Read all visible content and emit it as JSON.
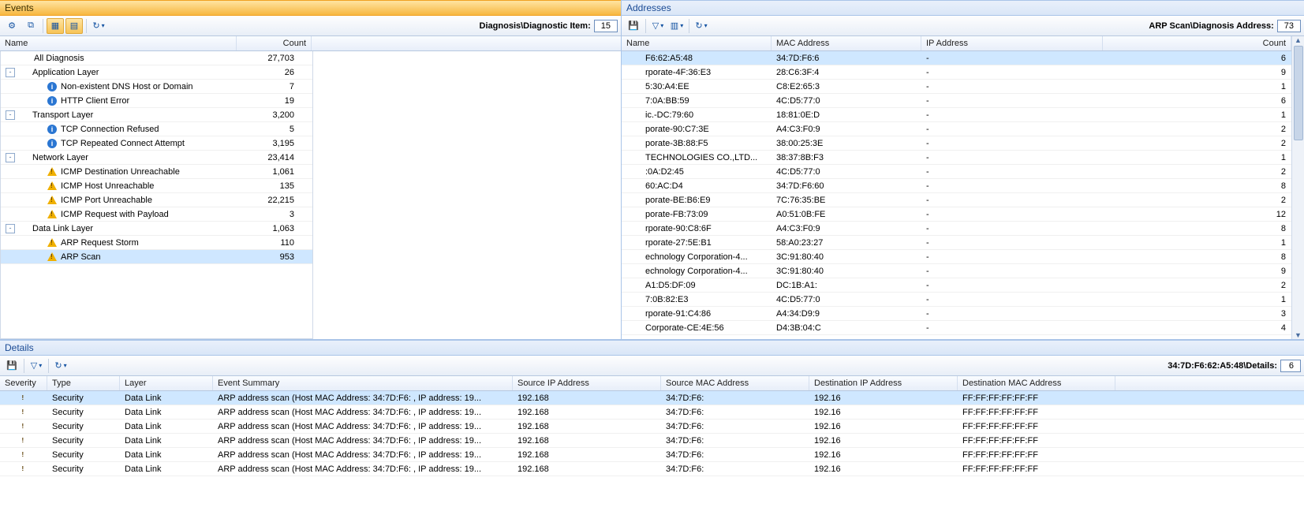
{
  "events": {
    "title": "Events",
    "breadcrumb_label": "Diagnosis\\Diagnostic Item:",
    "breadcrumb_count": "15",
    "columns": {
      "name": "Name",
      "count": "Count"
    },
    "tree": [
      {
        "label": "All Diagnosis",
        "count": "27,703",
        "indent": 1,
        "toggler": null,
        "icon": null
      },
      {
        "label": "Application Layer",
        "count": "26",
        "indent": 0,
        "toggler": "-",
        "icon": null
      },
      {
        "label": "Non-existent DNS Host or Domain",
        "count": "7",
        "indent": 2,
        "toggler": null,
        "icon": "info"
      },
      {
        "label": "HTTP Client Error",
        "count": "19",
        "indent": 2,
        "toggler": null,
        "icon": "info"
      },
      {
        "label": "Transport Layer",
        "count": "3,200",
        "indent": 0,
        "toggler": "-",
        "icon": null
      },
      {
        "label": "TCP Connection Refused",
        "count": "5",
        "indent": 2,
        "toggler": null,
        "icon": "info"
      },
      {
        "label": "TCP Repeated Connect Attempt",
        "count": "3,195",
        "indent": 2,
        "toggler": null,
        "icon": "info"
      },
      {
        "label": "Network Layer",
        "count": "23,414",
        "indent": 0,
        "toggler": "-",
        "icon": null
      },
      {
        "label": "ICMP Destination Unreachable",
        "count": "1,061",
        "indent": 2,
        "toggler": null,
        "icon": "warn"
      },
      {
        "label": "ICMP Host Unreachable",
        "count": "135",
        "indent": 2,
        "toggler": null,
        "icon": "warn"
      },
      {
        "label": "ICMP Port Unreachable",
        "count": "22,215",
        "indent": 2,
        "toggler": null,
        "icon": "warn"
      },
      {
        "label": "ICMP Request with Payload",
        "count": "3",
        "indent": 2,
        "toggler": null,
        "icon": "warn"
      },
      {
        "label": "Data Link Layer",
        "count": "1,063",
        "indent": 0,
        "toggler": "-",
        "icon": null
      },
      {
        "label": "ARP Request Storm",
        "count": "110",
        "indent": 2,
        "toggler": null,
        "icon": "warn"
      },
      {
        "label": "ARP Scan",
        "count": "953",
        "indent": 2,
        "toggler": null,
        "icon": "warn",
        "selected": true
      }
    ]
  },
  "addresses": {
    "title": "Addresses",
    "breadcrumb_label": "ARP Scan\\Diagnosis Address:",
    "breadcrumb_count": "73",
    "columns": {
      "name": "Name",
      "mac": "MAC Address",
      "ip": "IP Address",
      "count": "Count"
    },
    "rows": [
      {
        "name": "F6:62:A5:48",
        "mac": "34:7D:F6:6",
        "ip": "-",
        "count": "6",
        "selected": true
      },
      {
        "name": "rporate-4F:36:E3",
        "mac": "28:C6:3F:4",
        "ip": "-",
        "count": "9"
      },
      {
        "name": "5:30:A4:EE",
        "mac": "C8:E2:65:3",
        "ip": "-",
        "count": "1"
      },
      {
        "name": "7:0A:BB:59",
        "mac": "4C:D5:77:0",
        "ip": "-",
        "count": "6"
      },
      {
        "name": "ic.-DC:79:60",
        "mac": "18:81:0E:D",
        "ip": "-",
        "count": "1"
      },
      {
        "name": "porate-90:C7:3E",
        "mac": "A4:C3:F0:9",
        "ip": "-",
        "count": "2"
      },
      {
        "name": "porate-3B:88:F5",
        "mac": "38:00:25:3E",
        "ip": "-",
        "count": "2"
      },
      {
        "name": "TECHNOLOGIES CO.,LTD...",
        "mac": "38:37:8B:F3",
        "ip": "-",
        "count": "1"
      },
      {
        "name": ":0A:D2:45",
        "mac": "4C:D5:77:0",
        "ip": "-",
        "count": "2"
      },
      {
        "name": "60:AC:D4",
        "mac": "34:7D:F6:60",
        "ip": "-",
        "count": "8"
      },
      {
        "name": "porate-BE:B6:E9",
        "mac": "7C:76:35:BE",
        "ip": "-",
        "count": "2"
      },
      {
        "name": "porate-FB:73:09",
        "mac": "A0:51:0B:FE",
        "ip": "-",
        "count": "12"
      },
      {
        "name": "rporate-90:C8:6F",
        "mac": "A4:C3:F0:9",
        "ip": "-",
        "count": "8"
      },
      {
        "name": "rporate-27:5E:B1",
        "mac": "58:A0:23:27",
        "ip": "-",
        "count": "1"
      },
      {
        "name": "echnology Corporation-4...",
        "mac": "3C:91:80:40",
        "ip": "-",
        "count": "8"
      },
      {
        "name": "echnology Corporation-4...",
        "mac": "3C:91:80:40",
        "ip": "-",
        "count": "9"
      },
      {
        "name": "A1:D5:DF:09",
        "mac": "DC:1B:A1:",
        "ip": "-",
        "count": "2"
      },
      {
        "name": "7:0B:82:E3",
        "mac": "4C:D5:77:0",
        "ip": "-",
        "count": "1"
      },
      {
        "name": "rporate-91:C4:86",
        "mac": "A4:34:D9:9",
        "ip": "-",
        "count": "3"
      },
      {
        "name": "Corporate-CE:4E:56",
        "mac": "D4:3B:04:C",
        "ip": "-",
        "count": "4"
      }
    ]
  },
  "details": {
    "title": "Details",
    "breadcrumb_label": "34:7D:F6:62:A5:48\\Details:",
    "breadcrumb_count": "6",
    "columns": {
      "severity": "Severity",
      "type": "Type",
      "layer": "Layer",
      "summary": "Event Summary",
      "sip": "Source IP Address",
      "smac": "Source MAC Address",
      "dip": "Destination IP Address",
      "dmac": "Destination MAC Address"
    },
    "rows": [
      {
        "sev": "warn",
        "type": "Security",
        "layer": "Data Link",
        "summary": "ARP address scan (Host MAC Address: 34:7D:F6:      , IP address: 19...",
        "sip": "192.168",
        "smac": "34:7D:F6:",
        "dip": "192.16",
        "dmac": "FF:FF:FF:FF:FF:FF",
        "selected": true
      },
      {
        "sev": "warn",
        "type": "Security",
        "layer": "Data Link",
        "summary": "ARP address scan (Host MAC Address: 34:7D:F6:      , IP address: 19...",
        "sip": "192.168",
        "smac": "34:7D:F6:",
        "dip": "192.16",
        "dmac": "FF:FF:FF:FF:FF:FF"
      },
      {
        "sev": "warn",
        "type": "Security",
        "layer": "Data Link",
        "summary": "ARP address scan (Host MAC Address: 34:7D:F6:      , IP address: 19...",
        "sip": "192.168",
        "smac": "34:7D:F6:",
        "dip": "192.16",
        "dmac": "FF:FF:FF:FF:FF:FF"
      },
      {
        "sev": "warn",
        "type": "Security",
        "layer": "Data Link",
        "summary": "ARP address scan (Host MAC Address: 34:7D:F6:      , IP address: 19...",
        "sip": "192.168",
        "smac": "34:7D:F6:",
        "dip": "192.16",
        "dmac": "FF:FF:FF:FF:FF:FF"
      },
      {
        "sev": "warn",
        "type": "Security",
        "layer": "Data Link",
        "summary": "ARP address scan (Host MAC Address: 34:7D:F6:      , IP address: 19...",
        "sip": "192.168",
        "smac": "34:7D:F6:",
        "dip": "192.16",
        "dmac": "FF:FF:FF:FF:FF:FF"
      },
      {
        "sev": "warn",
        "type": "Security",
        "layer": "Data Link",
        "summary": "ARP address scan (Host MAC Address: 34:7D:F6:      , IP address: 19...",
        "sip": "192.168",
        "smac": "34:7D:F6:",
        "dip": "192.16",
        "dmac": "FF:FF:FF:FF:FF:FF"
      }
    ]
  },
  "icons": {
    "gear": "⚙",
    "copy": "⧉",
    "grid1": "▦",
    "grid2": "▤",
    "refresh": "↻",
    "save": "💾",
    "filter": "▽",
    "columns": "▥"
  }
}
